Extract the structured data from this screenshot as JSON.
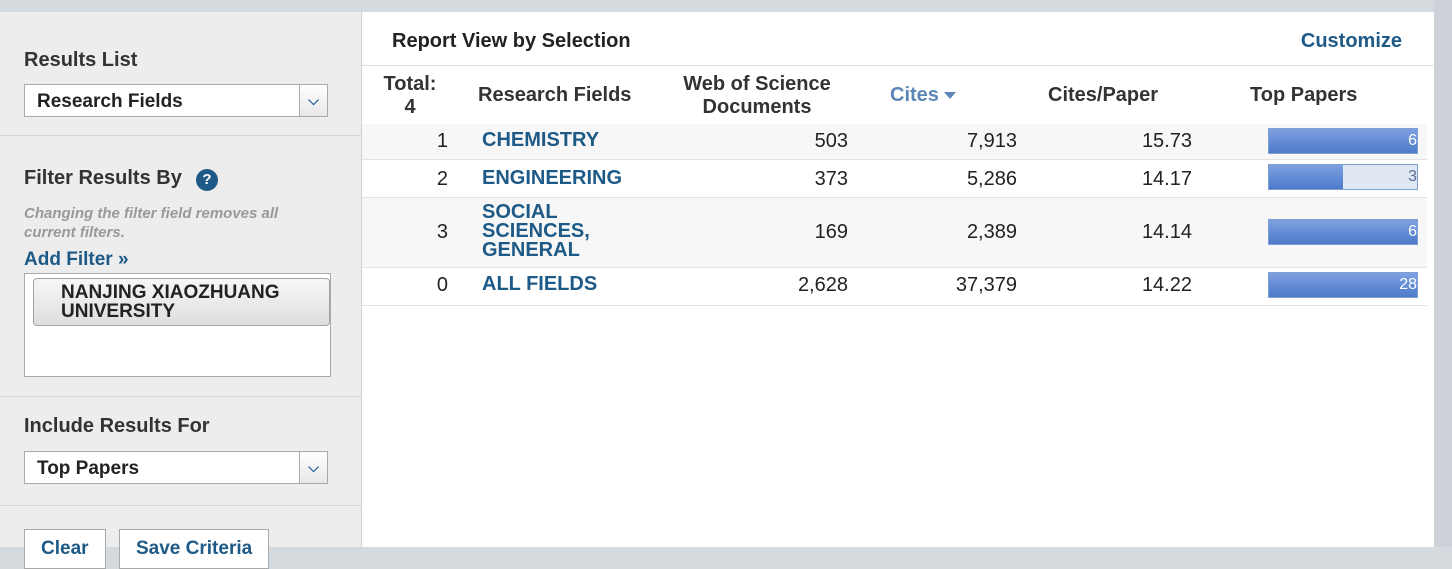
{
  "sidebar": {
    "results_list": {
      "heading": "Results List",
      "selected": "Research Fields"
    },
    "filter": {
      "heading": "Filter Results By",
      "help": "?",
      "note": "Changing the filter field removes all current filters.",
      "add_filter": "Add Filter »",
      "chips": [
        "NANJING XIAOZHUANG UNIVERSITY"
      ]
    },
    "include": {
      "heading": "Include Results For",
      "selected": "Top Papers"
    },
    "buttons": {
      "clear": "Clear",
      "save": "Save Criteria"
    },
    "dropdown_icon": "chevron-down-icon"
  },
  "report": {
    "title": "Report View by Selection",
    "customize": "Customize",
    "headers": {
      "total": "Total:",
      "total_count": "4",
      "field": "Research Fields",
      "docs_line1": "Web of Science",
      "docs_line2": "Documents",
      "cites": "Cites",
      "cites_per_paper": "Cites/Paper",
      "top_papers": "Top Papers"
    },
    "rows": [
      {
        "rank": "1",
        "field": "CHEMISTRY",
        "docs": "503",
        "cites": "7,913",
        "cpp": "15.73",
        "top": "6",
        "top_fraction": 1.0
      },
      {
        "rank": "2",
        "field": "ENGINEERING",
        "docs": "373",
        "cites": "5,286",
        "cpp": "14.17",
        "top": "3",
        "top_fraction": 0.5
      },
      {
        "rank": "3",
        "field": "SOCIAL SCIENCES, GENERAL",
        "docs": "169",
        "cites": "2,389",
        "cpp": "14.14",
        "top": "6",
        "top_fraction": 1.0
      },
      {
        "rank": "0",
        "field": "ALL FIELDS",
        "docs": "2,628",
        "cites": "37,379",
        "cpp": "14.22",
        "top": "28",
        "top_fraction": 1.0
      }
    ]
  },
  "colors": {
    "link": "#1e5a87",
    "bar_fill": "#4d7acb",
    "sort_header": "#5d86b8"
  }
}
